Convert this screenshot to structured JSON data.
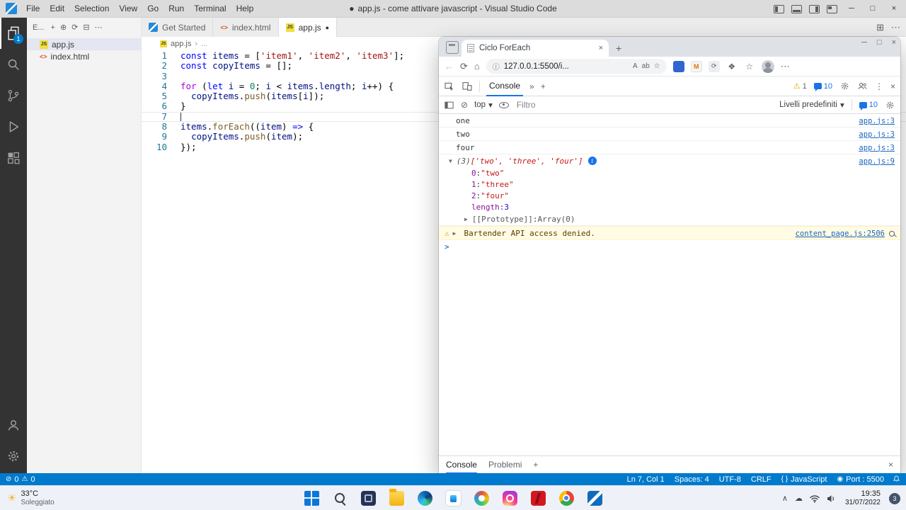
{
  "icons": {
    "minimize": "─",
    "maximize": "□",
    "close": "×",
    "more-h": "⋯",
    "more-v": "⋮",
    "plus": "+",
    "chevrons-right": "»",
    "caret-down": "▼",
    "caret-right": "▶",
    "chevron-down": "▾",
    "back": "←",
    "refresh": "⟳",
    "home": "⌂",
    "info-circle": "ⓘ",
    "warning": "⚠",
    "block": "⊘",
    "breadcrumb-sep": "›",
    "ellipsis": "…",
    "star-add": "☆",
    "read-aloud": "A",
    "translate": "ab",
    "braces": "{ }",
    "broadcast": "◉",
    "chevron-up": "∧",
    "cloud": "☁",
    "sun": "☀",
    "dirty-dot": "●",
    "split-editor": "⊞",
    "fi-js": "JS",
    "fi-html": "<>",
    "prompt-chevron": ">",
    "collapse-all": "⊟",
    "new-file": "+",
    "new-folder": "⊕",
    "puzzle": "❖",
    "hub-star": "☆",
    "info-i": "i"
  },
  "window": {
    "dirty_dot": "●",
    "title": "app.js - come attivare javascript - Visual Studio Code",
    "menus": [
      "File",
      "Edit",
      "Selection",
      "View",
      "Go",
      "Run",
      "Terminal",
      "Help"
    ]
  },
  "activity_bar": {
    "explorer_badge": "1"
  },
  "sidebar": {
    "header": "E...",
    "files": [
      {
        "name": "app.js",
        "icon": "js",
        "selected": true
      },
      {
        "name": "index.html",
        "icon": "html",
        "selected": false
      }
    ]
  },
  "tabs": [
    {
      "label": "Get Started",
      "icon": "vscode",
      "active": false,
      "dirty": false
    },
    {
      "label": "index.html",
      "icon": "html",
      "active": false,
      "dirty": false
    },
    {
      "label": "app.js",
      "icon": "js",
      "active": true,
      "dirty": true
    }
  ],
  "breadcrumb": {
    "file": "app.js",
    "more": "..."
  },
  "editor": {
    "lines": [
      {
        "n": 1,
        "tokens": [
          [
            "kw",
            "const"
          ],
          [
            "pl",
            " "
          ],
          [
            "vr",
            "items"
          ],
          [
            "pl",
            " = ["
          ],
          [
            "st",
            "'item1'"
          ],
          [
            "pl",
            ", "
          ],
          [
            "st",
            "'item2'"
          ],
          [
            "pl",
            ", "
          ],
          [
            "st",
            "'item3'"
          ],
          [
            "pl",
            "];"
          ]
        ]
      },
      {
        "n": 2,
        "tokens": [
          [
            "kw",
            "const"
          ],
          [
            "pl",
            " "
          ],
          [
            "vr",
            "copyItems"
          ],
          [
            "pl",
            " = [];"
          ]
        ]
      },
      {
        "n": 3,
        "tokens": []
      },
      {
        "n": 4,
        "tokens": [
          [
            "ct",
            "for"
          ],
          [
            "pl",
            " ("
          ],
          [
            "kw",
            "let"
          ],
          [
            "pl",
            " "
          ],
          [
            "vr",
            "i"
          ],
          [
            "pl",
            " = "
          ],
          [
            "nu",
            "0"
          ],
          [
            "pl",
            "; "
          ],
          [
            "vr",
            "i"
          ],
          [
            "pl",
            " < "
          ],
          [
            "vr",
            "items"
          ],
          [
            "pl",
            "."
          ],
          [
            "vr",
            "length"
          ],
          [
            "pl",
            "; "
          ],
          [
            "vr",
            "i"
          ],
          [
            "pl",
            "++) {"
          ]
        ]
      },
      {
        "n": 5,
        "tokens": [
          [
            "pl",
            "  "
          ],
          [
            "vr",
            "copyItems"
          ],
          [
            "pl",
            "."
          ],
          [
            "fn",
            "push"
          ],
          [
            "pl",
            "("
          ],
          [
            "vr",
            "items"
          ],
          [
            "pl",
            "["
          ],
          [
            "vr",
            "i"
          ],
          [
            "pl",
            "]);"
          ]
        ]
      },
      {
        "n": 6,
        "tokens": [
          [
            "pl",
            "}"
          ]
        ]
      },
      {
        "n": 7,
        "tokens": [],
        "current": true
      },
      {
        "n": 8,
        "tokens": [
          [
            "vr",
            "items"
          ],
          [
            "pl",
            "."
          ],
          [
            "fn",
            "forEach"
          ],
          [
            "pl",
            "(("
          ],
          [
            "vr",
            "item"
          ],
          [
            "pl",
            ") "
          ],
          [
            "kw",
            "=>"
          ],
          [
            "pl",
            " {"
          ]
        ]
      },
      {
        "n": 9,
        "tokens": [
          [
            "pl",
            "  "
          ],
          [
            "vr",
            "copyItems"
          ],
          [
            "pl",
            "."
          ],
          [
            "fn",
            "push"
          ],
          [
            "pl",
            "("
          ],
          [
            "vr",
            "item"
          ],
          [
            "pl",
            ");"
          ]
        ]
      },
      {
        "n": 10,
        "tokens": [
          [
            "pl",
            "});"
          ]
        ]
      }
    ]
  },
  "browser": {
    "tab_title": "Ciclo ForEach",
    "url": "127.0.0.1:5500/i...",
    "devtools": {
      "panel_tab": "Console",
      "warning_count": "1",
      "message_count": "10",
      "context": "top",
      "filter_placeholder": "Filtro",
      "levels_label": "Livelli predefiniti",
      "levels_count": "10",
      "drawer_tabs": [
        {
          "label": "Console",
          "active": true
        },
        {
          "label": "Problemi",
          "active": false
        }
      ],
      "console_rows": [
        {
          "kind": "log",
          "text": "one",
          "link": "app.js:3"
        },
        {
          "kind": "log",
          "text": "two",
          "link": "app.js:3"
        },
        {
          "kind": "log",
          "text": "four",
          "link": "app.js:3"
        },
        {
          "kind": "array",
          "count": "(3) ",
          "array": "['two', 'three', 'four']",
          "link": "app.js:9"
        },
        {
          "kind": "prop",
          "key": "0",
          "value": "\"two\"",
          "vt": "str"
        },
        {
          "kind": "prop",
          "key": "1",
          "value": "\"three\"",
          "vt": "str"
        },
        {
          "kind": "prop",
          "key": "2",
          "value": "\"four\"",
          "vt": "str"
        },
        {
          "kind": "prop",
          "key": "length",
          "value": "3",
          "vt": "num"
        },
        {
          "kind": "proto",
          "key": "[[Prototype]]",
          "value": "Array(0)"
        },
        {
          "kind": "warn",
          "text": "Bartender API access denied.",
          "link": "content_page.js:2506"
        },
        {
          "kind": "prompt"
        }
      ]
    }
  },
  "statusbar": {
    "errors": "0",
    "warnings": "0",
    "right": [
      {
        "name": "cursor-position",
        "label": "Ln 7, Col 1"
      },
      {
        "name": "indentation",
        "label": "Spaces: 4"
      },
      {
        "name": "encoding",
        "label": "UTF-8"
      },
      {
        "name": "eol",
        "label": "CRLF"
      },
      {
        "name": "language-mode",
        "icon": "{ }",
        "label": "JavaScript"
      },
      {
        "name": "live-server-port",
        "icon": "◉",
        "label": "Port : 5500"
      }
    ]
  },
  "taskbar": {
    "weather_temp": "33°C",
    "weather_desc": "Soleggiato",
    "apps": [
      "windows-start",
      "search",
      "task-view",
      "file-explorer",
      "edge",
      "store",
      "photos",
      "instagram",
      "netflix",
      "chrome",
      "vscode"
    ],
    "time": "19:35",
    "date": "31/07/2022",
    "badge": "3"
  }
}
